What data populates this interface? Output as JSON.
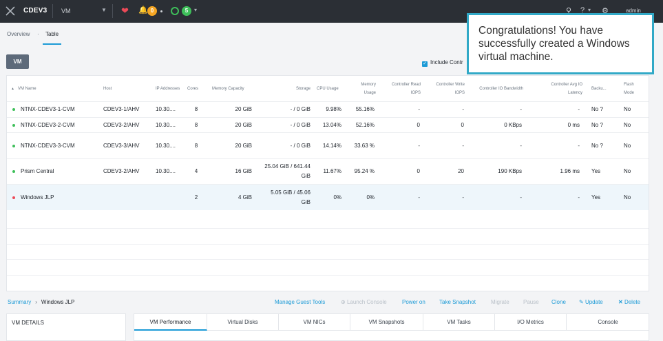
{
  "topbar": {
    "cluster_name": "CDEV3",
    "section": "VM",
    "alert_count": "0",
    "task_count": "5",
    "user": "admin"
  },
  "subnav": {
    "overview": "Overview",
    "separator": "·",
    "table": "Table"
  },
  "toolbar": {
    "vm_button": "VM",
    "include_label": "Include Contr"
  },
  "table": {
    "headers": [
      "VM Name",
      "Host",
      "IP Addresses",
      "Cores",
      "Memory Capacity",
      "Storage",
      "CPU Usage",
      "Memory Usage",
      "Controller Read IOPS",
      "Controller Write IOPS",
      "Controller IO Bandwidth",
      "Controller Avg IO Latency",
      "Backu...",
      "Flash Mode"
    ],
    "rows": [
      {
        "name": "NTNX-CDEV3-1-CVM",
        "status": "green",
        "host": "CDEV3-1/AHV",
        "ip": "10.30....",
        "cores": "8",
        "memory": "20 GiB",
        "storage": "- / 0 GiB",
        "cpu": "9.98%",
        "mem_usage": "55.16%",
        "read_iops": "-",
        "write_iops": "-",
        "bandwidth": "-",
        "latency": "-",
        "backup": "No ?",
        "flash": "No"
      },
      {
        "name": "NTNX-CDEV3-2-CVM",
        "status": "green",
        "host": "CDEV3-2/AHV",
        "ip": "10.30....",
        "cores": "8",
        "memory": "20 GiB",
        "storage": "- / 0 GiB",
        "cpu": "13.04%",
        "mem_usage": "52.16%",
        "read_iops": "0",
        "write_iops": "0",
        "bandwidth": "0 KBps",
        "latency": "0 ms",
        "backup": "No ?",
        "flash": "No"
      },
      {
        "name": "NTNX-CDEV3-3-CVM",
        "status": "green",
        "host": "CDEV3-3/AHV",
        "ip": "10.30....",
        "cores": "8",
        "memory": "20 GiB",
        "storage": "- / 0 GiB",
        "cpu": "14.14%",
        "mem_usage": "33.63 %",
        "read_iops": "-",
        "write_iops": "-",
        "bandwidth": "-",
        "latency": "-",
        "backup": "No ?",
        "flash": "No"
      },
      {
        "name": "Prism Central",
        "status": "green",
        "host": "CDEV3-2/AHV",
        "ip": "10.30....",
        "cores": "4",
        "memory": "16 GiB",
        "storage": "25.04 GiB / 641.44 GiB",
        "cpu": "11.67%",
        "mem_usage": "95.24 %",
        "read_iops": "0",
        "write_iops": "20",
        "bandwidth": "190 KBps",
        "latency": "1.96 ms",
        "backup": "Yes",
        "flash": "No"
      },
      {
        "name": "Windows JLP",
        "status": "red",
        "host": "",
        "ip": "",
        "cores": "2",
        "memory": "4 GiB",
        "storage": "5.05 GiB / 45.06 GiB",
        "cpu": "0%",
        "mem_usage": "0%",
        "read_iops": "-",
        "write_iops": "-",
        "bandwidth": "-",
        "latency": "-",
        "backup": "Yes",
        "flash": "No"
      }
    ]
  },
  "breadcrumb": {
    "root": "Summary",
    "current": "Windows JLP"
  },
  "actions": {
    "manage_guest_tools": "Manage Guest Tools",
    "launch_console": "Launch Console",
    "power_on": "Power on",
    "take_snapshot": "Take Snapshot",
    "migrate": "Migrate",
    "pause": "Pause",
    "clone": "Clone",
    "update": "Update",
    "delete": "Delete"
  },
  "details": {
    "title": "VM DETAILS"
  },
  "perf_tabs": [
    "VM Performance",
    "Virtual Disks",
    "VM NICs",
    "VM Snapshots",
    "VM Tasks",
    "I/O Metrics",
    "Console"
  ],
  "tooltip": {
    "message": "Congratulations! You have successfully created a Windows virtual machine."
  },
  "colors": {
    "accent": "#1b9ad6",
    "status_green": "#3ebf5a",
    "status_red": "#ec4a58",
    "tooltip_border": "#31a9c7"
  }
}
